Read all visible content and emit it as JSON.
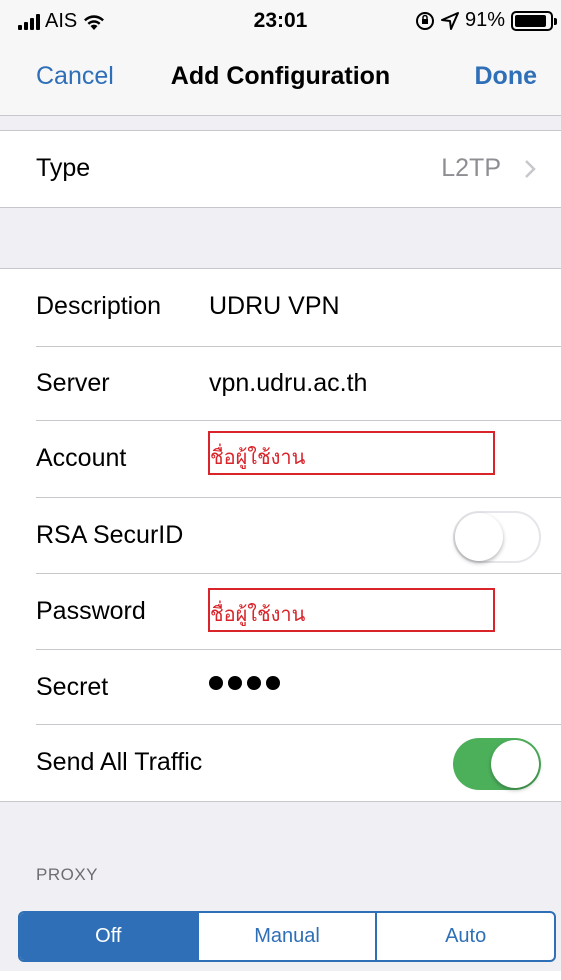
{
  "status_bar": {
    "carrier": "AIS",
    "time": "23:01",
    "battery": "91%",
    "battery_level": 0.91
  },
  "nav": {
    "cancel": "Cancel",
    "title": "Add Configuration",
    "done": "Done"
  },
  "type_row": {
    "label": "Type",
    "value": "L2TP"
  },
  "fields": {
    "description": {
      "label": "Description",
      "value": "UDRU VPN"
    },
    "server": {
      "label": "Server",
      "value": "vpn.udru.ac.th"
    },
    "account": {
      "label": "Account",
      "annotation": "ชื่อผู้ใช้งาน"
    },
    "rsa": {
      "label": "RSA SecurID",
      "on": false
    },
    "password": {
      "label": "Password",
      "annotation": "ชื่อผู้ใช้งาน"
    },
    "secret": {
      "label": "Secret",
      "masked_length": 4
    },
    "send_all": {
      "label": "Send All Traffic",
      "on": true
    }
  },
  "proxy": {
    "header": "PROXY",
    "options": [
      "Off",
      "Manual",
      "Auto"
    ],
    "selected": "Off"
  },
  "colors": {
    "accent": "#2e6fb7",
    "toggle_on": "#4cb05b",
    "annotation": "#d9242a"
  }
}
